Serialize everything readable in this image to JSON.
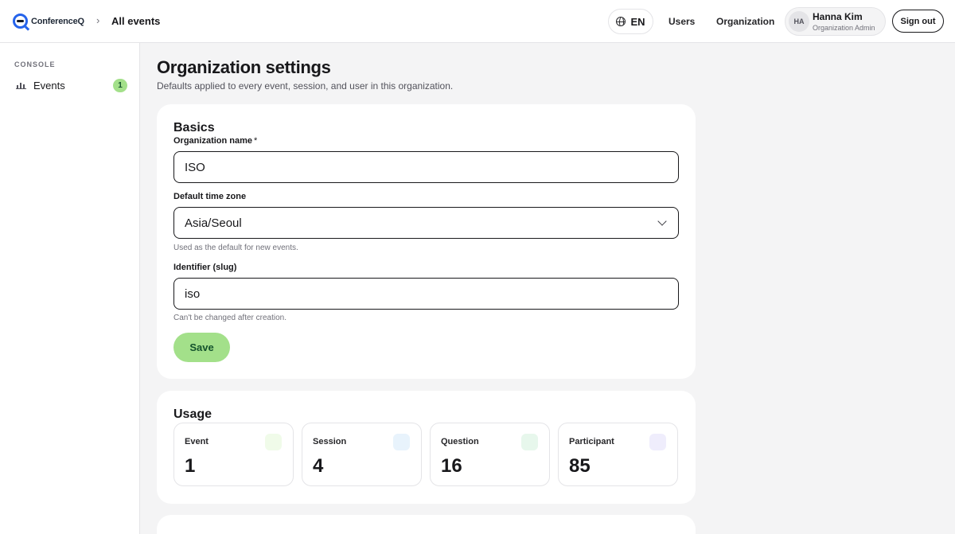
{
  "header": {
    "logo_text": "ConferenceQ",
    "breadcrumb_all": "All events",
    "language": "EN",
    "nav": {
      "users": "Users",
      "organization": "Organization"
    },
    "user": {
      "initials": "HA",
      "name": "Hanna Kim",
      "role": "Organization Admin"
    },
    "signout": "Sign out"
  },
  "sidebar": {
    "section": "CONSOLE",
    "items": [
      {
        "label": "Events",
        "badge": "1"
      }
    ]
  },
  "page": {
    "title": "Organization settings",
    "subtitle": "Defaults applied to every event, session, and user in this organization."
  },
  "basics": {
    "heading": "Basics",
    "org_name_label": "Organization name",
    "org_name_required": "*",
    "org_name_value": "ISO",
    "timezone_label": "Default time zone",
    "timezone_value": "Asia/Seoul",
    "timezone_help": "Used as the default for new events.",
    "slug_label": "Identifier (slug)",
    "slug_value": "iso",
    "slug_help": "Can't be changed after creation.",
    "save": "Save"
  },
  "usage": {
    "heading": "Usage",
    "stats": [
      {
        "label": "Event",
        "value": "1",
        "color": "#f0fbe9"
      },
      {
        "label": "Session",
        "value": "4",
        "color": "#e8f3fc"
      },
      {
        "label": "Question",
        "value": "16",
        "color": "#e7f7ec"
      },
      {
        "label": "Participant",
        "value": "85",
        "color": "#efedfc"
      }
    ]
  },
  "colors": {
    "accent": "#a3e08a",
    "brand": "#2563eb",
    "text": "#18181b"
  }
}
